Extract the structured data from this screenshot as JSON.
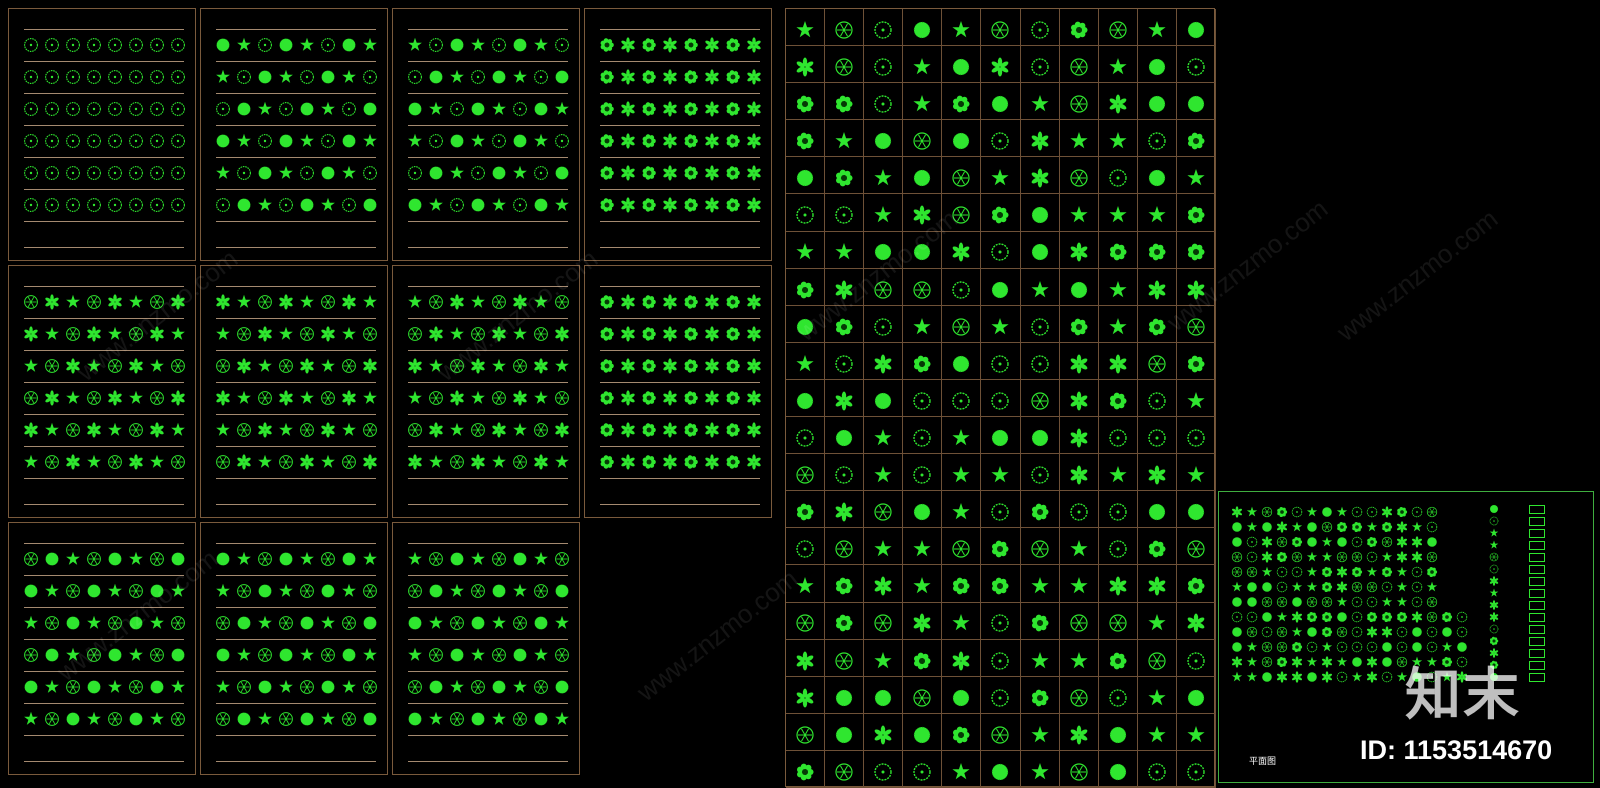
{
  "canvas": {
    "background": "#000000",
    "symbol_color": "#2fe62f",
    "frame_color": "#7a5a3c"
  },
  "watermark": {
    "text": "www.znzmo.com",
    "brand": "知末",
    "id_label": "ID: 1153514670"
  },
  "legend": {
    "caption": "平面图"
  },
  "icon_names": [
    "tree-plan-icon",
    "shrub-plan-icon",
    "palm-plan-icon",
    "flower-plan-icon",
    "hedge-plan-icon"
  ]
}
